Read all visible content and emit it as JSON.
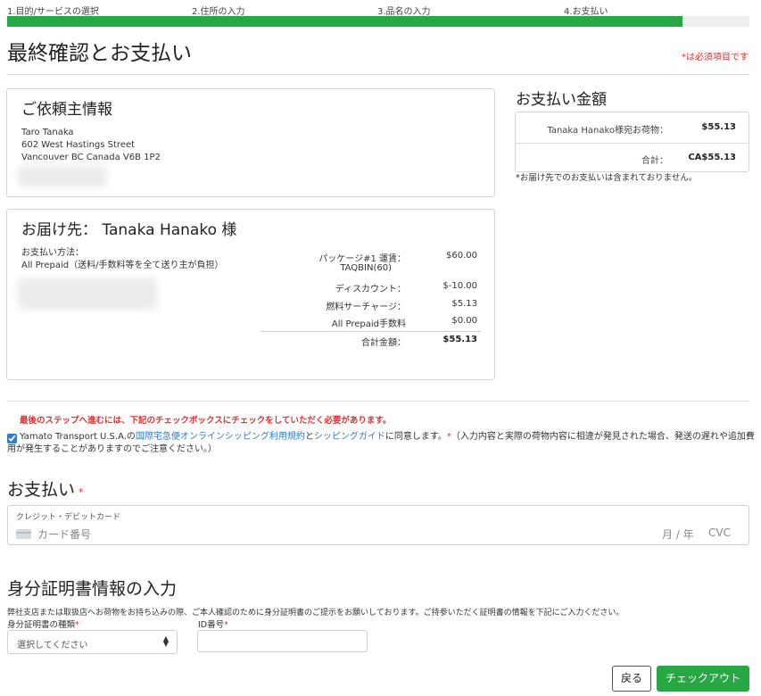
{
  "steps": [
    {
      "label": "1.目的/サービスの選択"
    },
    {
      "label": "2.住所の入力"
    },
    {
      "label": "3.品名の入力"
    },
    {
      "label": "4.お支払い"
    }
  ],
  "progress_percent": 91,
  "page": {
    "title": "最終確認とお支払い",
    "required_note": "*は必須項目です"
  },
  "sender": {
    "heading": "ご依頼主情報",
    "name": "Taro Tanaka",
    "street": "602 West Hastings Street",
    "city": "Vancouver BC Canada V6B 1P2"
  },
  "recipient": {
    "heading": "お届け先： Tanaka Hanako 様",
    "payment_method_label": "お支払い方法：",
    "payment_method_value": "All Prepaid（送料/手数料等を全て送り主が負担）",
    "lines": [
      {
        "label": "パッケージ#1 運賃：",
        "sub": "TAQBIN(60)",
        "value": "$60.00"
      },
      {
        "label": "ディスカウント：",
        "value": "$-10.00"
      },
      {
        "label": "燃料サーチャージ：",
        "value": "$5.13"
      },
      {
        "label": "All Prepaid手数料",
        "value": "$0.00"
      }
    ],
    "total_label": "合計金額：",
    "total_value": "$55.13"
  },
  "payment_summary": {
    "heading": "お支払い金額",
    "rows": [
      {
        "label": "Tanaka Hanako様宛お荷物：",
        "value": "$55.13"
      },
      {
        "label": "合計：",
        "value": "CA$55.13"
      }
    ],
    "note": "*お届け先でのお支払いは含まれておりません。"
  },
  "terms": {
    "warning": "最後のステップへ進むには、下記のチェックボックスにチェックをしていただく必要があります。",
    "checked": true,
    "text_before": "Yamato Transport U.S.A.の",
    "link1": "国際宅急便オンラインシッピング利用規約",
    "mid": "と",
    "link2": "シッピングガイド",
    "text_after": "に同意します。",
    "required_mark": "*",
    "note_line1": "（入力内容と実際の荷物内容に相違が発見された場合、発送の遅れや追加費",
    "note_line2": "用が発生することがありますのでご注意ください。）"
  },
  "payment": {
    "heading": "お支払い",
    "required_mark": "*",
    "card_label": "クレジット・デビットカード",
    "card_placeholder": "カード番号",
    "expiry_placeholder": "月 / 年",
    "cvc_placeholder": "CVC"
  },
  "id_section": {
    "heading": "身分証明書情報の入力",
    "description": "弊社支店または取扱店へお荷物をお持ち込みの際、ご本人確認のために身分証明書のご提示をお願いしております。ご持参いただく証明書の情報を下記にご入力ください。",
    "type_label": "身分証明書の種類",
    "type_selected": "選択してください",
    "number_label": "ID番号",
    "required_mark": "*"
  },
  "buttons": {
    "back": "戻る",
    "checkout": "チェックアウト"
  },
  "colors": {
    "accent_green": "#28a745",
    "required_red": "#e03030",
    "link_blue": "#2f7bd6"
  }
}
